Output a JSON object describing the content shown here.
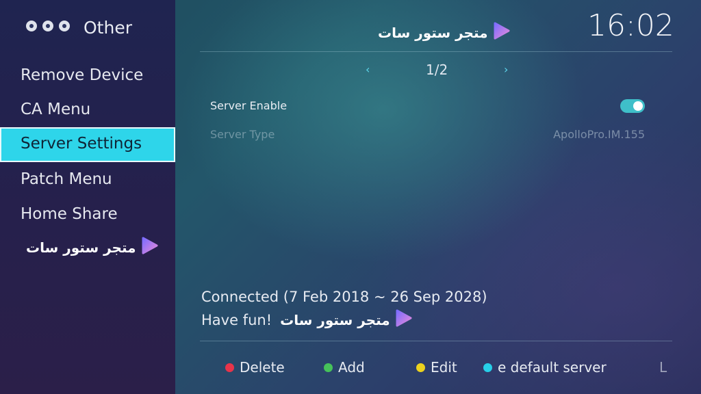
{
  "sidebar": {
    "title": "Other",
    "items": [
      {
        "label": "Remove Device",
        "active": false
      },
      {
        "label": "CA Menu",
        "active": false
      },
      {
        "label": "Server Settings",
        "active": true
      },
      {
        "label": "Patch Menu",
        "active": false
      },
      {
        "label": "Home Share",
        "active": false
      }
    ],
    "brand": "متجر ستور سات"
  },
  "header": {
    "brand": "متجر ستور سات",
    "clock": "16:02"
  },
  "pager": {
    "text": "1/2",
    "prev_icon": "chevron-left-icon",
    "next_icon": "chevron-right-icon"
  },
  "settings": {
    "server_enable": {
      "label": "Server Enable",
      "enabled": true
    },
    "server_type": {
      "label": "Server Type",
      "value": "ApolloPro.IM.155"
    }
  },
  "status": {
    "connected": "Connected (7 Feb 2018 ~ 26 Sep 2028)",
    "have_fun": "Have fun!",
    "brand": "متجر ستور سات"
  },
  "footer": {
    "actions": [
      {
        "label": "Delete",
        "color": "#e8344a"
      },
      {
        "label": "Add",
        "color": "#46c25a"
      },
      {
        "label": "Edit",
        "color": "#ecd21e"
      },
      {
        "label": "e default server",
        "color": "#27cfe8"
      }
    ],
    "trailing": "L"
  },
  "colors": {
    "accent": "#2ed5ea",
    "toggle_on": "#3fbfc9"
  }
}
